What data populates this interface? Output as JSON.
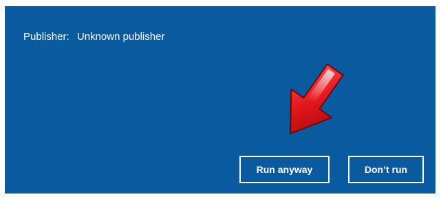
{
  "dialog": {
    "publisher_label": "Publisher:",
    "publisher_value": "Unknown publisher",
    "background_color": "#0a5aa0"
  },
  "buttons": {
    "run_anyway": "Run anyway",
    "dont_run": "Don’t run"
  },
  "annotation": {
    "icon": "red-arrow-icon",
    "color": "#d81418"
  }
}
